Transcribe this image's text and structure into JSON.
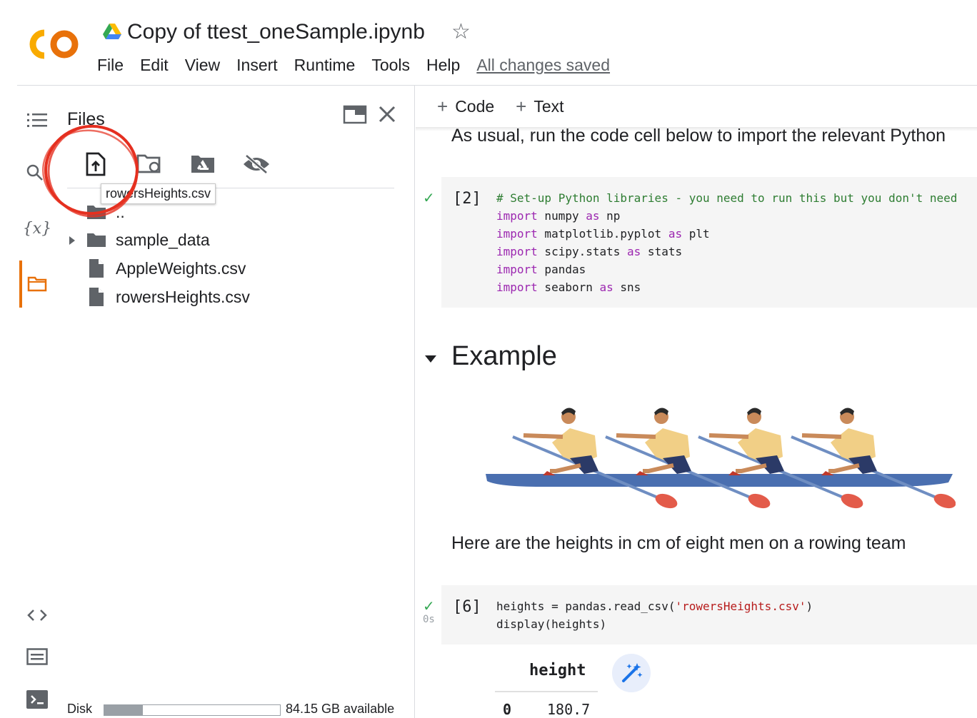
{
  "header": {
    "logo_text": "CO",
    "title": "Copy of ttest_oneSample.ipynb",
    "menu": [
      "File",
      "Edit",
      "View",
      "Insert",
      "Runtime",
      "Tools",
      "Help"
    ],
    "save_status": "All changes saved"
  },
  "files_panel": {
    "title": "Files",
    "tooltip": "rowersHeights.csv",
    "tree": [
      {
        "label": "..",
        "kind": "folder-up"
      },
      {
        "label": "sample_data",
        "kind": "folder"
      },
      {
        "label": "AppleWeights.csv",
        "kind": "file"
      },
      {
        "label": "rowersHeights.csv",
        "kind": "file"
      }
    ],
    "disk": {
      "label": "Disk",
      "available": "84.15 GB available",
      "used_fraction": 0.22
    }
  },
  "notebook": {
    "toolbar": {
      "add_code": "Code",
      "add_text": "Text"
    },
    "intro_text": "As usual, run the code cell below to import the relevant Python",
    "cell1": {
      "exec_count": "[2]",
      "lines": {
        "l1": "# Set-up Python libraries - you need to run this but you don't need",
        "l2_kw": "import",
        "l2_rest": " numpy ",
        "l2_as": "as",
        "l2_alias": " np",
        "l3_kw": "import",
        "l3_rest": " matplotlib.pyplot ",
        "l3_as": "as",
        "l3_alias": " plt",
        "l4_kw": "import",
        "l4_rest": " scipy.stats ",
        "l4_as": "as",
        "l4_alias": " stats",
        "l5_kw": "import",
        "l5_rest": " pandas",
        "l6_kw": "import",
        "l6_rest": " seaborn ",
        "l6_as": "as",
        "l6_alias": " sns"
      }
    },
    "heading": "Example",
    "body_text": "Here are the heights in cm of eight men on a rowing team",
    "cell2": {
      "exec_count": "[6]",
      "run_time": "0s",
      "line1_a": "heights = pandas.read_csv(",
      "line1_str": "'rowersHeights.csv'",
      "line1_b": ")",
      "line2": "display(heights)"
    },
    "table": {
      "column": "height",
      "rows": [
        {
          "index": "0",
          "value": "180.7"
        }
      ]
    }
  },
  "colors": {
    "accent": "#e8710a",
    "keyword": "#9c27b0",
    "string": "#b71c1c",
    "comment": "#2e7d32",
    "check": "#34a853",
    "annotation": "#e53020"
  }
}
